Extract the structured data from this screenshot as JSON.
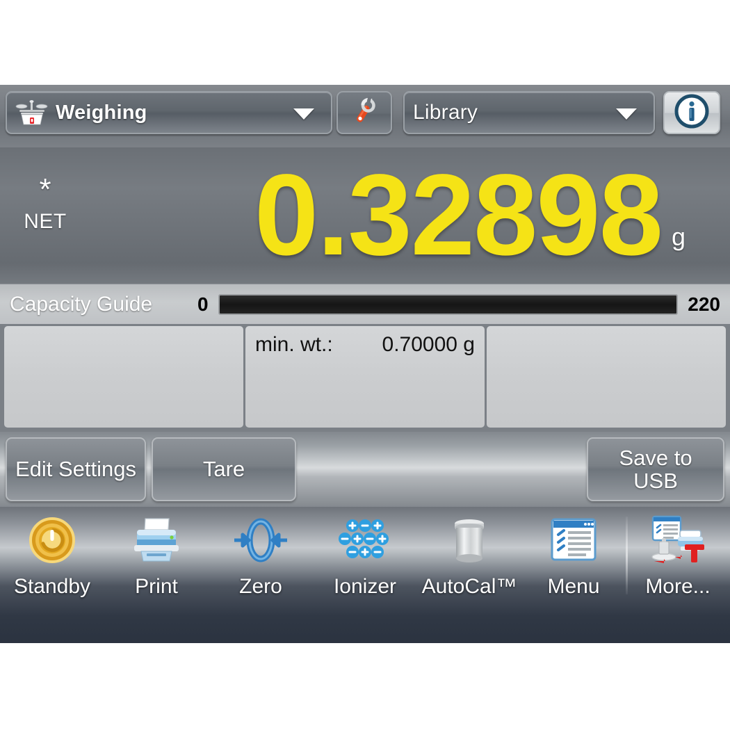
{
  "header": {
    "mode_dropdown": {
      "label": "Weighing",
      "icon": "balance-scale-icon",
      "arrow": "chevron-down-icon"
    },
    "settings_button": {
      "icon": "wrench-icon"
    },
    "library_dropdown": {
      "label": "Library",
      "arrow": "chevron-down-icon"
    },
    "info_button": {
      "icon": "info-icon"
    }
  },
  "display": {
    "stability_flag": "*",
    "net_flag": "NET",
    "weight": "0.32898",
    "unit": "g",
    "weight_color": "#f5e316"
  },
  "capacity": {
    "label": "Capacity Guide",
    "min": "0",
    "max": "220",
    "fill_percent": 0
  },
  "panels": [
    {
      "key": "",
      "value": ""
    },
    {
      "key": "min. wt.:",
      "value": "0.70000 g"
    },
    {
      "key": "",
      "value": ""
    }
  ],
  "actions": {
    "edit_settings": "Edit Settings",
    "tare": "Tare",
    "save_to_usb": "Save to\nUSB",
    "save_to_usb_line1": "Save to",
    "save_to_usb_line2": "USB"
  },
  "toolbar": [
    {
      "label": "Standby",
      "icon": "power-standby-icon"
    },
    {
      "label": "Print",
      "icon": "printer-icon"
    },
    {
      "label": "Zero",
      "icon": "zero-arrows-icon"
    },
    {
      "label": "Ionizer",
      "icon": "ionizer-charges-icon"
    },
    {
      "label": "AutoCal™",
      "icon": "calibration-weight-icon"
    },
    {
      "label": "Menu",
      "icon": "menu-list-window-icon"
    },
    {
      "label": "More...",
      "icon": "more-applications-icon"
    }
  ],
  "colors": {
    "accent_yellow": "#f5e316",
    "panel_gray": "#cbcdcf",
    "toolbar_dark": "#2b3340",
    "chrome_gray": "#787d83"
  }
}
